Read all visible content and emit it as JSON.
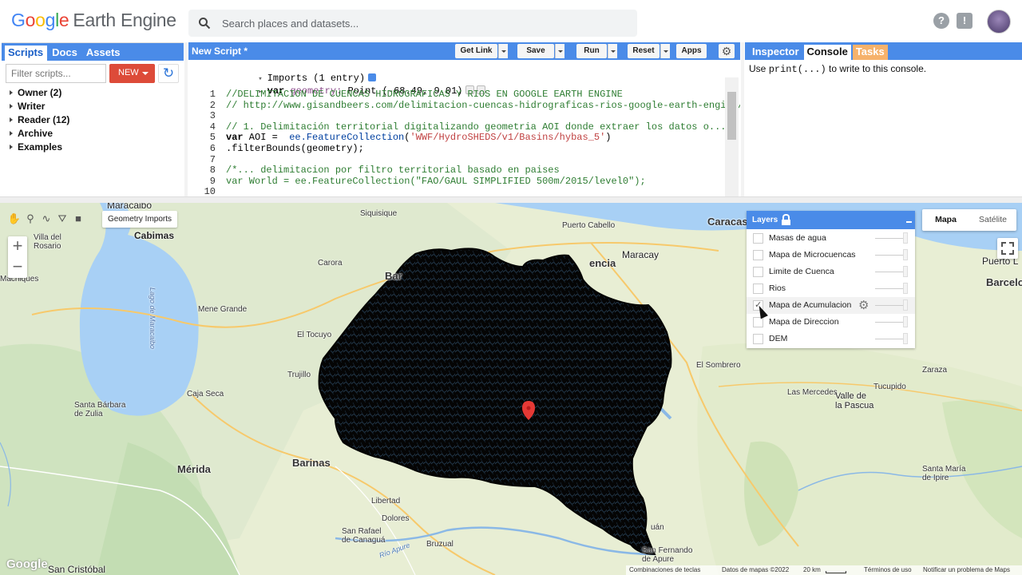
{
  "header": {
    "logo_letters": [
      "G",
      "o",
      "o",
      "g",
      "l",
      "e"
    ],
    "logo_rest": "Earth Engine",
    "search_placeholder": "Search places and datasets...",
    "help_icon": "?",
    "feedback_icon": "!"
  },
  "left_panel": {
    "tabs": [
      "Scripts",
      "Docs",
      "Assets"
    ],
    "filter_placeholder": "Filter scripts...",
    "new_label": "NEW",
    "refresh_icon": "↻",
    "tree": [
      "Owner (2)",
      "Writer",
      "Reader (12)",
      "Archive",
      "Examples"
    ]
  },
  "editor": {
    "title": "New Script *",
    "buttons": {
      "get_link": "Get Link",
      "save": "Save",
      "run": "Run",
      "reset": "Reset",
      "apps": "Apps"
    },
    "gear_icon": "⚙",
    "imports_label": "Imports (1 entry)",
    "import_var_keyword": "var",
    "import_var_name": "geometry:",
    "import_var_value": "Point (-68.49, 9.01)",
    "lines": [
      {
        "n": "1",
        "parts": [
          {
            "t": "cm",
            "s": "//DELIMITACION DE CUENCAS HIDROGRAFICAS Y RIOS EN GOOGLE EARTH ENGINE"
          }
        ]
      },
      {
        "n": "2",
        "parts": [
          {
            "t": "cm",
            "s": "// http://www.gisandbeers.com/delimitacion-cuencas-hidrograficas-rios-google-earth-engine/"
          }
        ]
      },
      {
        "n": "3",
        "parts": []
      },
      {
        "n": "4",
        "parts": [
          {
            "t": "cm",
            "s": "// 1. Delimitación territorial digitalizando geometria AOI donde extraer los datos o..."
          }
        ]
      },
      {
        "n": "5",
        "parts": [
          {
            "t": "kw",
            "s": "var"
          },
          {
            "t": "fn",
            "s": " AOI =  "
          },
          {
            "t": "ee",
            "s": "ee.FeatureCollection"
          },
          {
            "t": "fn",
            "s": "("
          },
          {
            "t": "str",
            "s": "'WWF/HydroSHEDS/v1/Basins/hybas_5'"
          },
          {
            "t": "fn",
            "s": ")"
          }
        ]
      },
      {
        "n": "6",
        "parts": [
          {
            "t": "fn",
            "s": ".filterBounds(geometry);"
          }
        ]
      },
      {
        "n": "7",
        "parts": []
      },
      {
        "n": "8",
        "parts": [
          {
            "t": "cm",
            "s": "/*... delimitacion por filtro territorial basado en paises"
          }
        ]
      },
      {
        "n": "9",
        "parts": [
          {
            "t": "cm",
            "s": "var World = ee.FeatureCollection(\"FAO/GAUL SIMPLIFIED 500m/2015/level0\");"
          }
        ]
      },
      {
        "n": "10",
        "parts": []
      }
    ]
  },
  "right_panel": {
    "tabs": [
      "Inspector",
      "Console",
      "Tasks"
    ],
    "console_pre": "Use ",
    "console_code": "print(...)",
    "console_post": " to write to this console."
  },
  "map": {
    "geometry_imports": "Geometry Imports",
    "zoom_in": "+",
    "zoom_out": "−",
    "tools": [
      "✋",
      "⚲",
      "∿",
      "⛛",
      "■"
    ],
    "layers_title": "Layers",
    "layers": [
      {
        "name": "Masas de agua",
        "checked": false
      },
      {
        "name": "Mapa de Microcuencas",
        "checked": false
      },
      {
        "name": "Limite de Cuenca",
        "checked": false
      },
      {
        "name": "Rios",
        "checked": false
      },
      {
        "name": "Mapa de Acumulacion",
        "checked": true
      },
      {
        "name": "Mapa de Direccion",
        "checked": false
      },
      {
        "name": "DEM",
        "checked": false
      }
    ],
    "layer_gear": "⚙",
    "map_types": [
      "Mapa",
      "Satélite"
    ],
    "places": {
      "maracaibo": "Maracaibo",
      "cabimas": "Cabimas",
      "villa_del_rosario": "Villa del\nRosario",
      "machiques": "Machiques",
      "lago": "Lago de Maracaibo",
      "mene_grande": "Mene Grande",
      "carora": "Carora",
      "siquisique": "Siquisique",
      "barquisimeto": "Bar",
      "el_tocuyo": "El Tocuyo",
      "trujillo": "Trujillo",
      "caja_seca": "Caja Seca",
      "santa_barbara": "Santa Bárbara\nde Zulia",
      "merida": "Mérida",
      "barinas": "Barinas",
      "libertad": "Libertad",
      "dolores": "Dolores",
      "san_rafael": "San Rafael\nde Canaguá",
      "bruzual": "Bruzual",
      "rio_apure": "Río Apure",
      "san_cristobal": "San Cristóbal",
      "caracas": "Caracas",
      "puerto_cabello": "Puerto Cabello",
      "valencia": "encia",
      "maracay": "Maracay",
      "el_sombrero": "El Sombrero",
      "las_mercedes": "Las Mercedes",
      "tucupido": "Tucupido",
      "zaraza": "Zaraza",
      "valle_pascua": "Valle de\nla Pascua",
      "santa_maria_de_ipire": "Santa María\nde Ipire",
      "san_fernando": "San Fernando\nde Apure",
      "barcelona": "Barcelo",
      "puerto_la_cruz": "Puerto L",
      "urbano": "uán"
    },
    "attribution": {
      "shortcuts": "Combinaciones de teclas",
      "map_data": "Datos de mapas ©2022",
      "scale": "20 km",
      "terms": "Términos de uso",
      "report": "Notificar un problema de Maps"
    },
    "google_logo": "Google"
  },
  "colors": {
    "accent_blue": "#4a8be8",
    "new_button": "#dd4b39",
    "tasks_tab": "#f6b26b",
    "marker": "#e53935"
  }
}
